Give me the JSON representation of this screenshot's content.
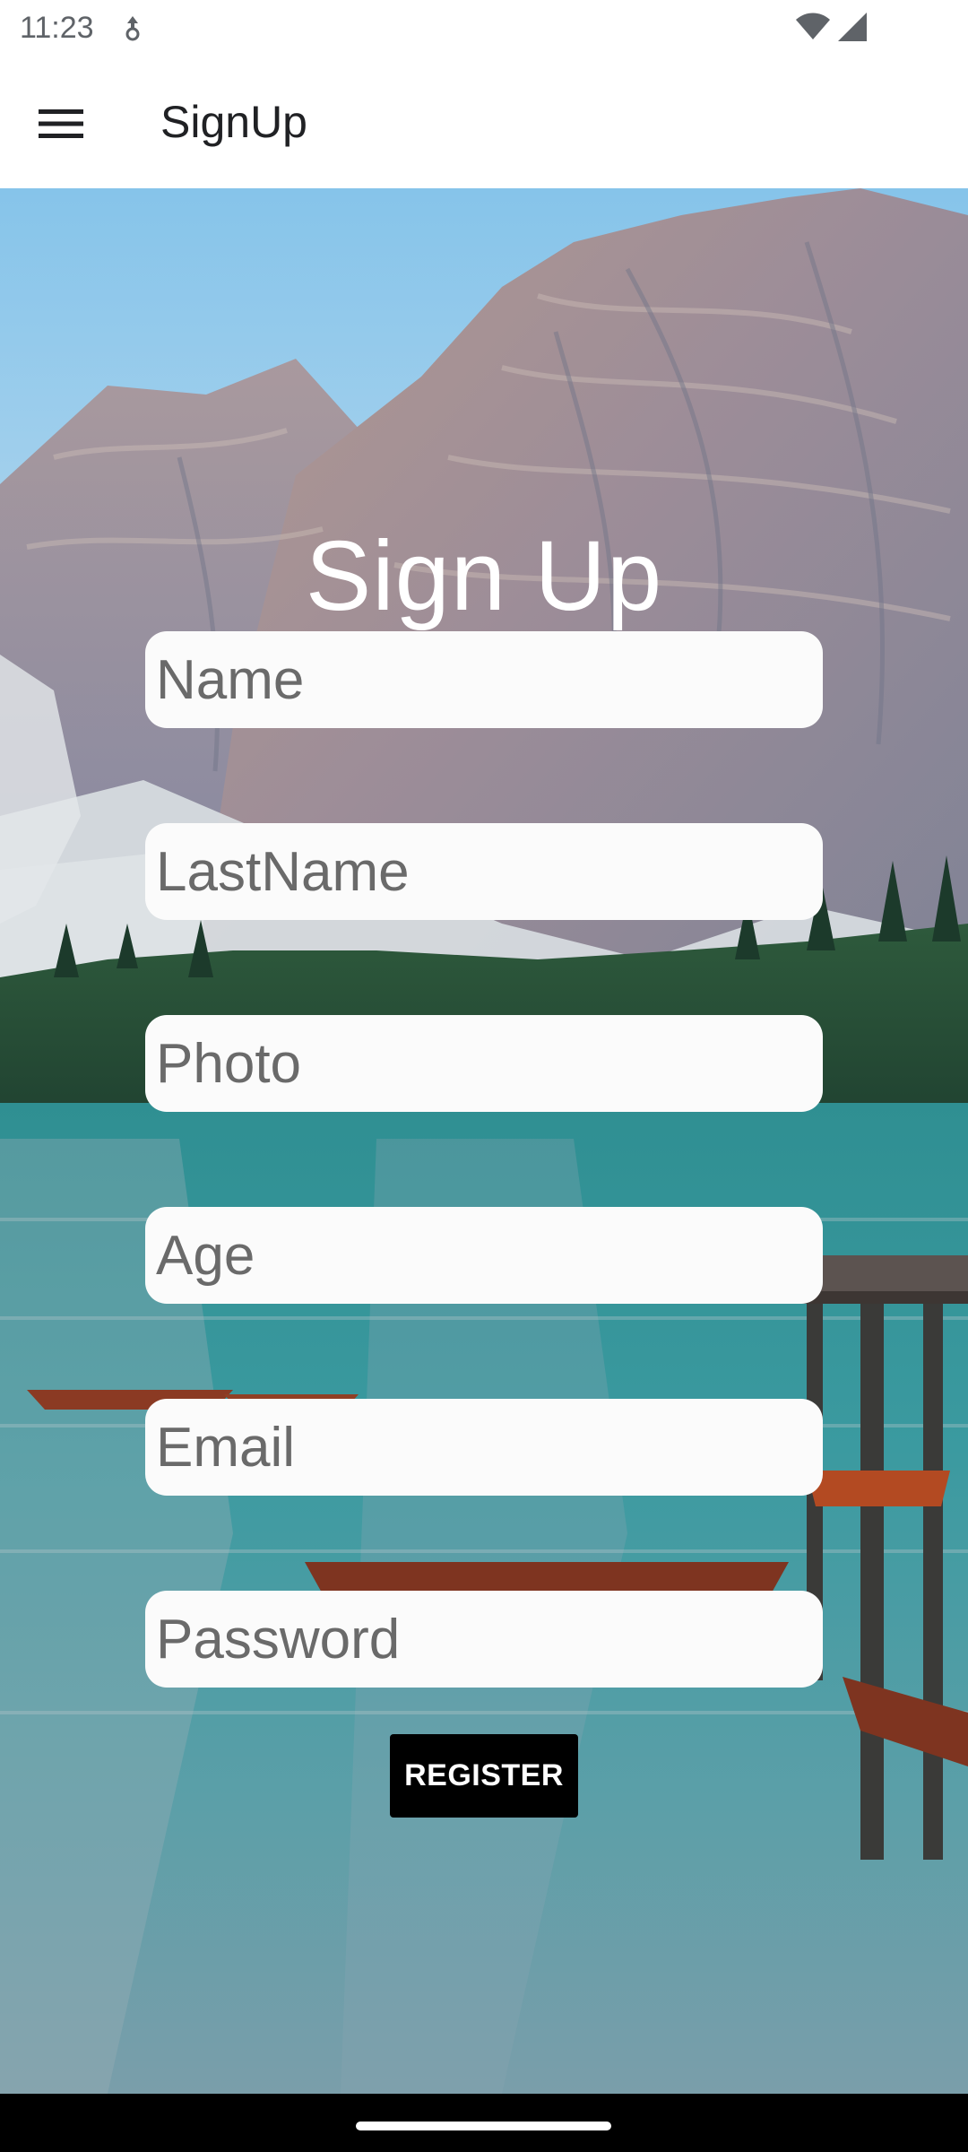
{
  "status_bar": {
    "time": "11:23",
    "icons": [
      "data-saver-icon",
      "wifi-icon",
      "cell-signal-icon"
    ]
  },
  "app_bar": {
    "menu_icon": "hamburger-menu-icon",
    "title": "SignUp"
  },
  "form": {
    "heading": "Sign Up",
    "fields": [
      {
        "name": "name-input",
        "placeholder": "Name"
      },
      {
        "name": "lastname-input",
        "placeholder": "LastName"
      },
      {
        "name": "photo-input",
        "placeholder": "Photo"
      },
      {
        "name": "age-input",
        "placeholder": "Age"
      },
      {
        "name": "email-input",
        "placeholder": "Email"
      },
      {
        "name": "password-input",
        "placeholder": "Password"
      }
    ],
    "register_label": "REGISTER"
  },
  "colors": {
    "app_bar_bg": "#ffffff",
    "field_bg": "#fbfbfb",
    "button_bg": "#000000",
    "button_text": "#ffffff",
    "heading_text": "#ffffff"
  }
}
